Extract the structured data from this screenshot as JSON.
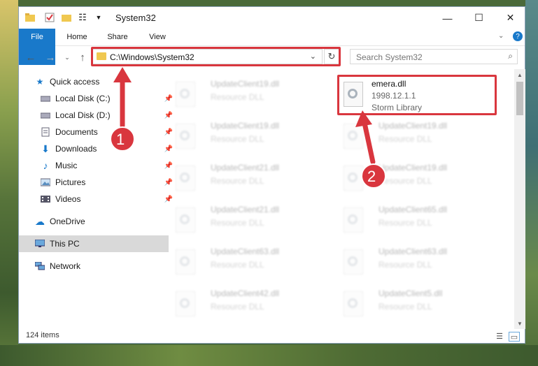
{
  "window": {
    "title": "System32",
    "controls": {
      "minimize": "—",
      "maximize": "☐",
      "close": "✕"
    }
  },
  "ribbon": {
    "tabs": [
      "File",
      "Home",
      "Share",
      "View"
    ]
  },
  "address": {
    "path": "C:\\Windows\\System32",
    "search_placeholder": "Search System32"
  },
  "sidebar": {
    "quick_access": "Quick access",
    "items": [
      {
        "label": "Local Disk (C:)",
        "icon": "drive-icon"
      },
      {
        "label": "Local Disk (D:)",
        "icon": "drive-icon"
      },
      {
        "label": "Documents",
        "icon": "documents-icon"
      },
      {
        "label": "Downloads",
        "icon": "downloads-icon"
      },
      {
        "label": "Music",
        "icon": "music-icon"
      },
      {
        "label": "Pictures",
        "icon": "pictures-icon"
      },
      {
        "label": "Videos",
        "icon": "videos-icon"
      }
    ],
    "onedrive": "OneDrive",
    "this_pc": "This PC",
    "network": "Network"
  },
  "files": {
    "highlighted": {
      "name": "emera.dll",
      "version": "1998.12.1.1",
      "company": "Storm Library"
    },
    "left_column": [
      {
        "name": "UpdateClient19.dll",
        "type": "Resource DLL"
      },
      {
        "name": "UpdateClient19.dll",
        "type": "Resource DLL"
      },
      {
        "name": "UpdateClient21.dll",
        "type": "Resource DLL"
      },
      {
        "name": "UpdateClient21.dll",
        "type": "Resource DLL"
      },
      {
        "name": "UpdateClient63.dll",
        "type": "Resource DLL"
      },
      {
        "name": "UpdateClient42.dll",
        "type": "Resource DLL"
      }
    ],
    "right_column": [
      {
        "name": "UpdateClient19.dll",
        "type": "Resource DLL"
      },
      {
        "name": "UpdateClient19.dll",
        "type": "Resource DLL"
      },
      {
        "name": "UpdateClient65.dll",
        "type": "Resource DLL"
      },
      {
        "name": "UpdateClient63.dll",
        "type": "Resource DLL"
      },
      {
        "name": "UpdateClient5.dll",
        "type": "Resource DLL"
      }
    ]
  },
  "status": {
    "items": "124 items"
  },
  "annotations": {
    "step1": "1",
    "step2": "2",
    "color": "#d9363e"
  }
}
